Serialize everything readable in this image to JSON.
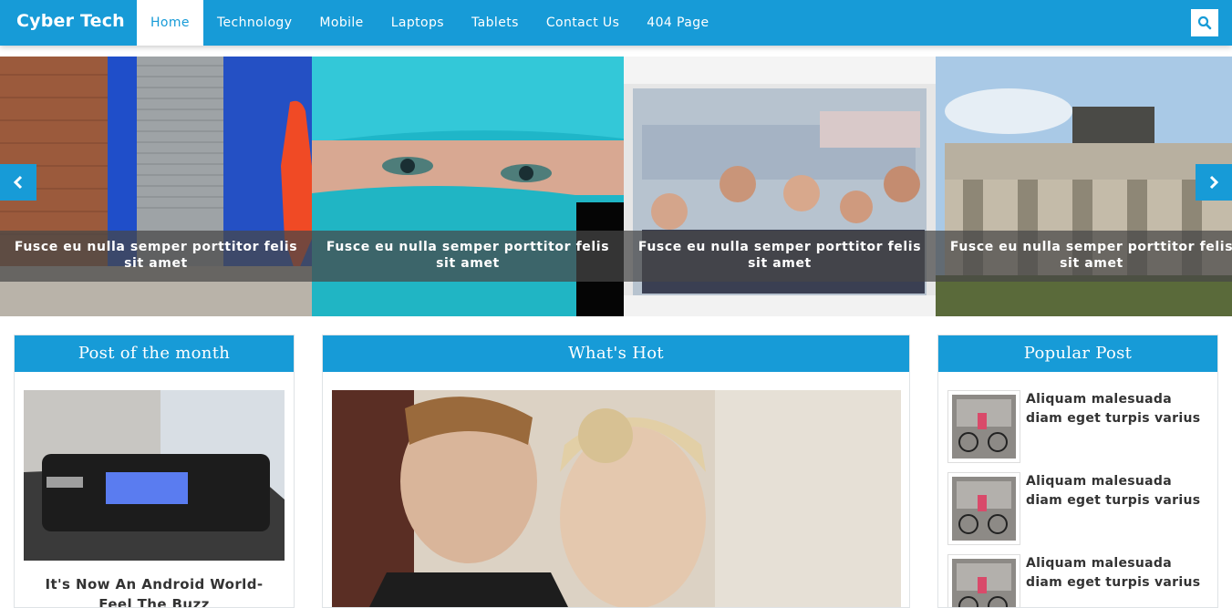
{
  "site": {
    "logo": "Cyber Tech"
  },
  "nav": {
    "items": [
      {
        "label": "Home",
        "active": true
      },
      {
        "label": "Technology"
      },
      {
        "label": "Mobile"
      },
      {
        "label": "Laptops"
      },
      {
        "label": "Tablets"
      },
      {
        "label": "Contact Us"
      },
      {
        "label": "404 Page"
      }
    ],
    "search_icon": "search-icon"
  },
  "slider": {
    "slides": [
      {
        "caption": "Fusce eu nulla semper porttitor felis sit amet"
      },
      {
        "caption": "Fusce eu nulla semper porttitor felis sit amet"
      },
      {
        "caption": "Fusce eu nulla semper porttitor felis sit amet"
      },
      {
        "caption": "Fusce eu nulla semper porttitor felis sit amet"
      }
    ],
    "prev_icon": "chevron-left-icon",
    "next_icon": "chevron-right-icon"
  },
  "widgets": {
    "post_of_month": {
      "title": "Post of the month",
      "post_title": "It's Now An Android World- Feel The Buzz"
    },
    "whats_hot": {
      "title": "What's Hot"
    },
    "popular": {
      "title": "Popular Post",
      "items": [
        {
          "title": "Aliquam malesuada diam eget turpis varius"
        },
        {
          "title": "Aliquam malesuada diam eget turpis varius"
        },
        {
          "title": "Aliquam malesuada diam eget turpis varius"
        }
      ]
    }
  },
  "colors": {
    "accent": "#179bd7",
    "header_text": "#ffffff",
    "caption_bg": "#464646"
  }
}
